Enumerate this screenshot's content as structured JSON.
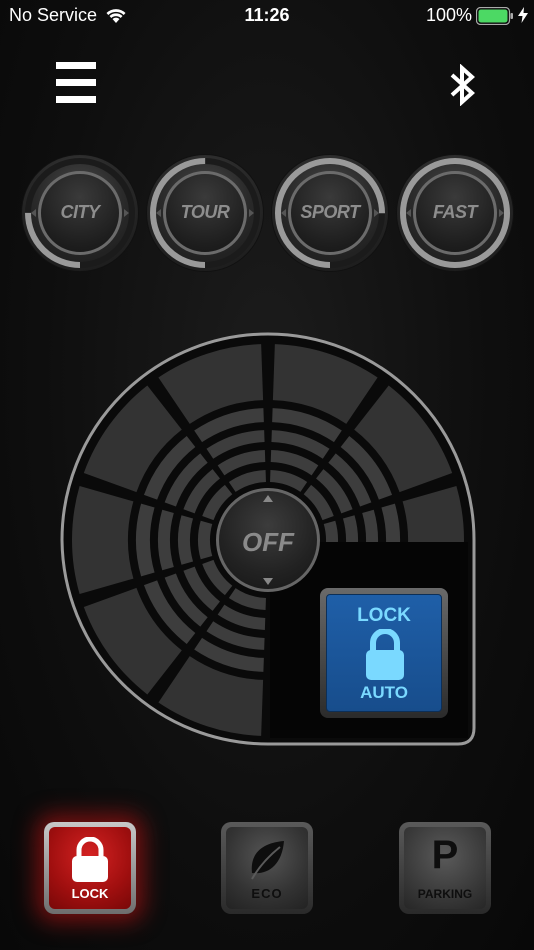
{
  "status_bar": {
    "carrier": "No Service",
    "time": "11:26",
    "battery_percent": "100%"
  },
  "header": {
    "menu_icon": "hamburger-menu-icon",
    "bluetooth_icon": "bluetooth-icon"
  },
  "modes": [
    {
      "label": "CITY",
      "level": 0.25
    },
    {
      "label": "TOUR",
      "level": 0.5
    },
    {
      "label": "SPORT",
      "level": 0.75
    },
    {
      "label": "FAST",
      "level": 1.0
    }
  ],
  "dial": {
    "center_label": "OFF",
    "lock_auto_top": "LOCK",
    "lock_auto_bottom": "AUTO"
  },
  "bottom_buttons": {
    "lock_label": "LOCK",
    "eco_label": "ECO",
    "parking_letter": "P",
    "parking_label": "PARKING"
  },
  "colors": {
    "background": "#0e0e0e",
    "lock_active": "#c41818",
    "lock_auto_blue": "#1f5fa8",
    "lock_auto_text": "#7ad9ff",
    "battery_green": "#4cd964"
  }
}
